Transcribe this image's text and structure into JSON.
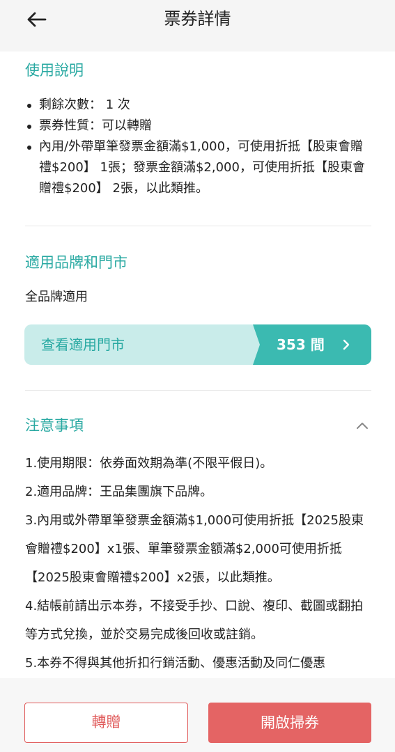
{
  "header": {
    "title": "票券詳情"
  },
  "usage": {
    "title": "使用說明",
    "items": [
      "剩餘次數： 1 次",
      "票券性質：可以轉贈",
      "內用/外帶單筆發票金額滿$1,000，可使用折抵【股東會贈禮$200】 1張；發票金額滿$2,000，可使用折抵【股東會贈禮$200】 2張，以此類推。"
    ]
  },
  "brands": {
    "title": "適用品牌和門市",
    "description": "全品牌適用",
    "store_link_label": "查看適用門市",
    "store_count": "353 間"
  },
  "notes": {
    "title": "注意事項",
    "items": [
      "1.使用期限：依券面效期為準(不限平假日)。",
      "2.適用品牌：王品集團旗下品牌。",
      "3.內用或外帶單筆發票金額滿$1,000可使用折抵【2025股東會贈禮$200】x1張、單筆發票金額滿$2,000可使用折抵【2025股東會贈禮$200】x2張，以此類推。",
      "4.結帳前請出示本券，不接受手抄、口說、複印、截圖或翻拍等方式兌換，並於交易完成後回收或註銷。",
      "5.本券不得與其他折扣行銷活動、優惠活動及同仁優惠"
    ]
  },
  "actions": {
    "gift_label": "轉贈",
    "scan_label": "開啟掃券"
  },
  "colors": {
    "accent": "#29a9a2",
    "accent_dark": "#3bbab1",
    "accent_light": "#c9ecea",
    "danger": "#e46464"
  }
}
